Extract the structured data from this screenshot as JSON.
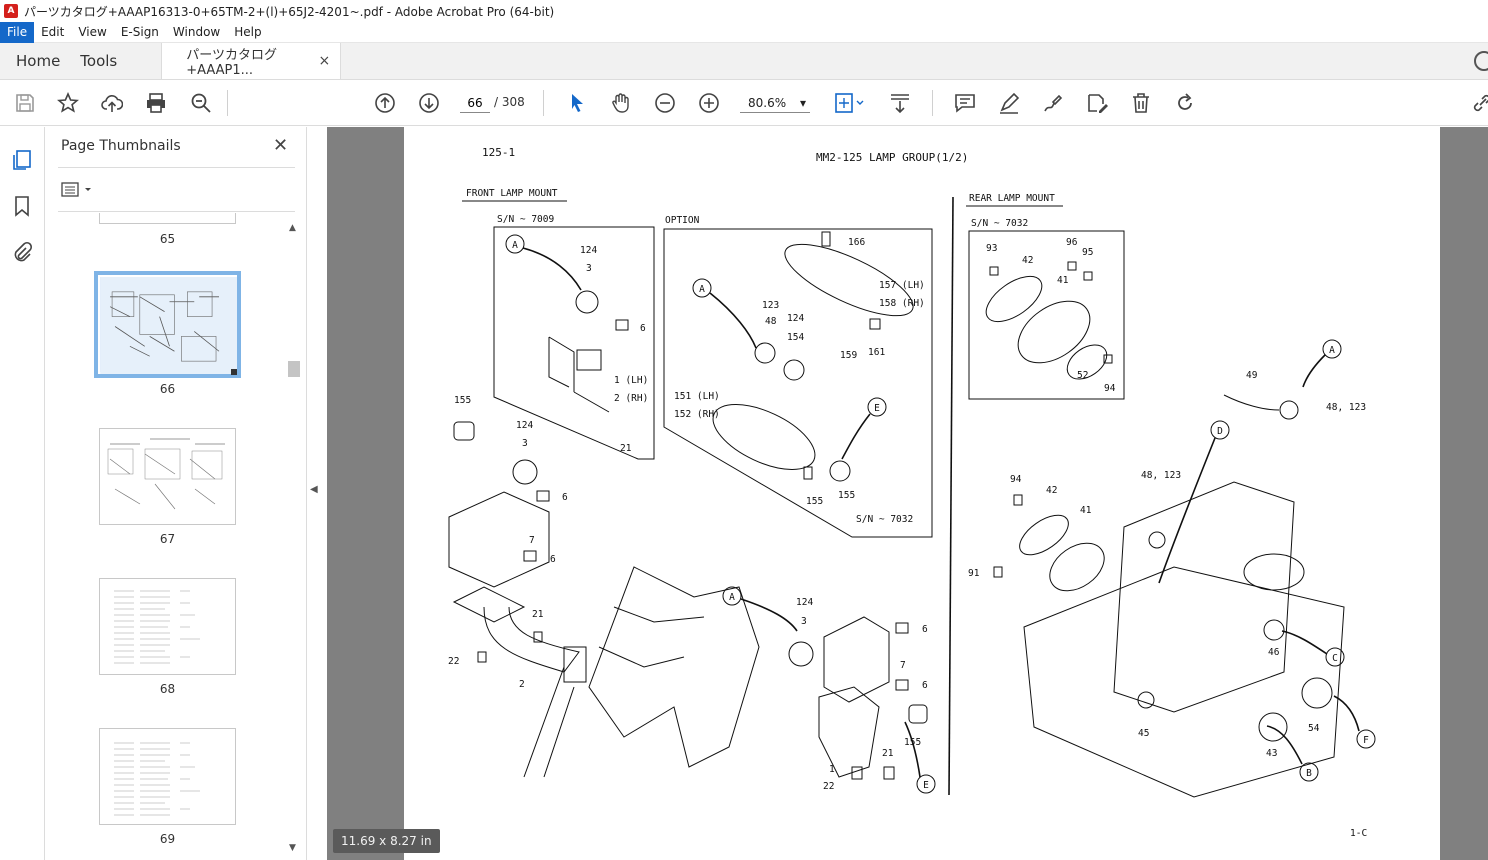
{
  "window": {
    "title": "パーツカタログ+AAAP16313-0+65TM-2+(l)+65J2-4201~.pdf - Adobe Acrobat Pro (64-bit)"
  },
  "menubar": {
    "items": [
      "File",
      "Edit",
      "View",
      "E-Sign",
      "Window",
      "Help"
    ]
  },
  "tabs": {
    "home": "Home",
    "tools": "Tools",
    "doc": "パーツカタログ+AAAP1...",
    "close": "×"
  },
  "toolbar": {
    "page_current": "66",
    "page_total": "/  308",
    "zoom": "80.6%",
    "zoom_arrow": "▾"
  },
  "thumbnails_panel": {
    "title": "Page Thumbnails",
    "close": "✕",
    "pages": [
      "65",
      "66",
      "67",
      "68",
      "69"
    ],
    "selected_page": "66"
  },
  "document": {
    "dimensions_label": "11.69 x 8.27 in",
    "page_ref": "125-1",
    "header": "MM2-125    LAMP GROUP(1/2)",
    "front_lamp_mount": "FRONT LAMP MOUNT",
    "sn_front": "S/N ~ 7009",
    "option": "OPTION",
    "rear_lamp_mount": "REAR LAMP MOUNT",
    "sn_rear": "S/N ~ 7032",
    "sn_option": "S/N ~ 7032",
    "footer": "1-C",
    "part_numbers": {
      "n124a": "124",
      "n3a": "3",
      "n6a": "6",
      "n1lh": "1 (LH)",
      "n2rh": "2 (RH)",
      "n21a": "21",
      "n166": "166",
      "n157lh": "157 (LH)",
      "n158rh": "158 (RH)",
      "n161": "161",
      "n123": "123",
      "n48": "48",
      "n124b": "124",
      "n154": "154",
      "n159": "159",
      "n151lh": "151 (LH)",
      "n152rh": "152 (RH)",
      "n155a": "155",
      "n155b": "155",
      "n93": "93",
      "n96": "96",
      "n95": "95",
      "n42a": "42",
      "n41a": "41",
      "n52": "52",
      "n94a": "94",
      "n155c": "155",
      "n124c": "124",
      "n3b": "3",
      "n6b": "6",
      "n7a": "7",
      "n6c": "6",
      "n21b": "21",
      "n22a": "22",
      "n2": "2",
      "n124d": "124",
      "n3c": "3",
      "n6d": "6",
      "n7b": "7",
      "n6e": "6",
      "n155d": "155",
      "n21c": "21",
      "n1": "1",
      "n22b": "22",
      "n49": "49",
      "n48_123a": "48, 123",
      "n94b": "94",
      "n42b": "42",
      "n41b": "41",
      "n48_123b": "48, 123",
      "n91": "91",
      "n46": "46",
      "n45": "45",
      "n43": "43",
      "n54": "54"
    },
    "callouts": [
      "A",
      "A",
      "E",
      "A",
      "A",
      "E",
      "D",
      "C",
      "B",
      "F"
    ]
  }
}
